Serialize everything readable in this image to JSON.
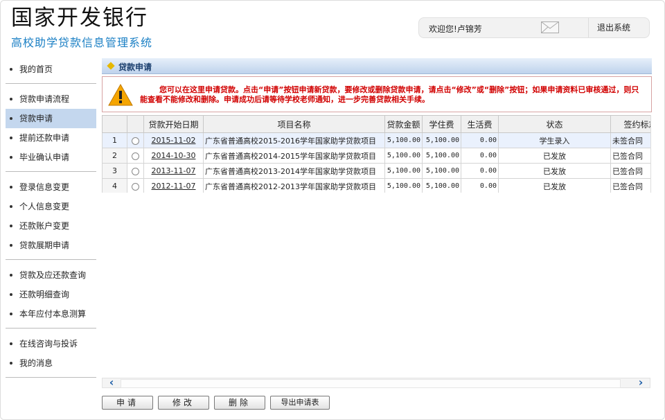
{
  "header": {
    "bank_name": "国家开发银行",
    "system_name": "高校助学贷款信息管理系统",
    "welcome": "欢迎您!卢锦芳",
    "logout": "退出系统"
  },
  "sidebar": {
    "groups": [
      [
        {
          "label": "我的首页"
        }
      ],
      [
        {
          "label": "贷款申请流程"
        },
        {
          "label": "贷款申请",
          "active": true
        },
        {
          "label": "提前还款申请"
        },
        {
          "label": "毕业确认申请"
        }
      ],
      [
        {
          "label": "登录信息变更"
        },
        {
          "label": "个人信息变更"
        },
        {
          "label": "还款账户变更"
        },
        {
          "label": "贷款展期申请"
        }
      ],
      [
        {
          "label": "贷款及应还款查询"
        },
        {
          "label": "还款明细查询"
        },
        {
          "label": "本年应付本息测算"
        }
      ],
      [
        {
          "label": "在线咨询与投诉"
        },
        {
          "label": "我的消息"
        }
      ]
    ]
  },
  "panel": {
    "title": "贷款申请",
    "notice": "您可以在这里申请贷款。点击“申请”按钮申请新贷款，要修改或删除贷款申请，请点击“修改”或“删除”按钮；如果申请资料已审核通过，则只能查看不能修改和删除。申请成功后请等待学校老师通知，进一步完善贷款相关手续。"
  },
  "table": {
    "columns": {
      "start_date": "贷款开始日期",
      "project": "项目名称",
      "amount": "贷款金额",
      "tuition": "学住费",
      "living": "生活费",
      "status": "状态",
      "sign": "签约标志"
    },
    "rows": [
      {
        "idx": "1",
        "date": "2015-11-02",
        "project": "广东省普通高校2015-2016学年国家助学贷款项目",
        "amount": "5,100.00",
        "tuition": "5,100.00",
        "living": "0.00",
        "status": "学生录入",
        "sign": "未签合同"
      },
      {
        "idx": "2",
        "date": "2014-10-30",
        "project": "广东省普通高校2014-2015学年国家助学贷款项目",
        "amount": "5,100.00",
        "tuition": "5,100.00",
        "living": "0.00",
        "status": "已发放",
        "sign": "已签合同"
      },
      {
        "idx": "3",
        "date": "2013-11-07",
        "project": "广东省普通高校2013-2014学年国家助学贷款项目",
        "amount": "5,100.00",
        "tuition": "5,100.00",
        "living": "0.00",
        "status": "已发放",
        "sign": "已签合同"
      },
      {
        "idx": "4",
        "date": "2012-11-07",
        "project": "广东省普通高校2012-2013学年国家助学贷款项目",
        "amount": "5,100.00",
        "tuition": "5,100.00",
        "living": "0.00",
        "status": "已发放",
        "sign": "已签合同"
      }
    ]
  },
  "buttons": {
    "apply": "申请",
    "modify": "修改",
    "delete": "删除",
    "export": "导出申请表"
  },
  "icons": {
    "mail": "mail-icon",
    "warning": "warning-icon",
    "scroll_left": "‹",
    "scroll_right": "›"
  }
}
